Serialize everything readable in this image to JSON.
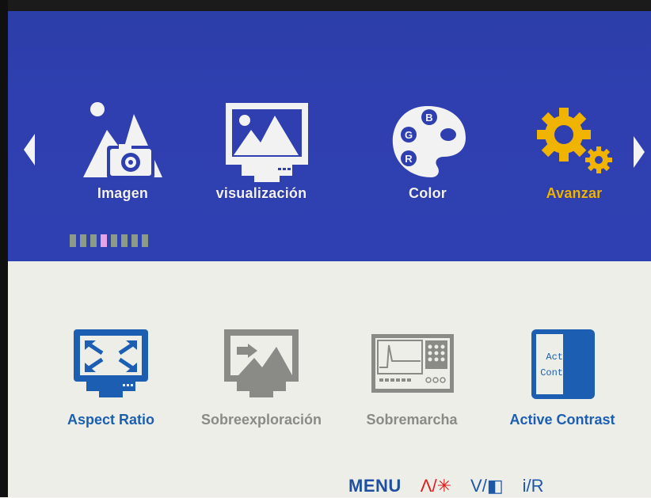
{
  "top_menu": {
    "items": [
      {
        "label": "Imagen",
        "icon": "image-icon",
        "active": false
      },
      {
        "label": "visualización",
        "icon": "display-icon",
        "active": false
      },
      {
        "label": "Color",
        "icon": "palette-icon",
        "active": false
      },
      {
        "label": "Avanzar",
        "icon": "gear-icon",
        "active": true
      }
    ],
    "page_indicator": {
      "total": 8,
      "active_index": 3
    }
  },
  "submenu": {
    "items": [
      {
        "label": "Aspect Ratio",
        "icon": "aspect-ratio-icon",
        "enabled": true
      },
      {
        "label": "Sobreexploración",
        "icon": "overscan-icon",
        "enabled": false
      },
      {
        "label": "Sobremarcha",
        "icon": "overdrive-icon",
        "enabled": false
      },
      {
        "label": "Active Contrast",
        "icon": "active-contrast-icon",
        "enabled": true
      }
    ],
    "active_contrast_icon_text": [
      "Active",
      "Contrast"
    ]
  },
  "footer": {
    "menu": "MENU",
    "up": "Λ/",
    "up_symbol": "✳",
    "down": "V/",
    "down_symbol": "◧",
    "info": "i/R"
  },
  "colors": {
    "top_bg": "#2f3fb0",
    "active_accent": "#f0b400",
    "sub_active": "#1c5fb2",
    "sub_disabled": "#8a8a86",
    "footer_red": "#e01c1c"
  }
}
